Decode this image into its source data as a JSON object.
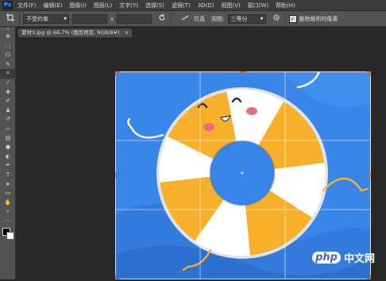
{
  "app": {
    "logo": "Ps"
  },
  "menu": [
    "文件(F)",
    "编辑(E)",
    "图像(I)",
    "图层(L)",
    "文字(Y)",
    "选择(S)",
    "滤镜(T)",
    "3D(D)",
    "视图(V)",
    "窗口(W)",
    "帮助(H)"
  ],
  "options": {
    "tool_icon": "crop-icon",
    "ratio_select": "不受约束",
    "x_label": "x",
    "straighten_label": "拉直",
    "view_label": "视图:",
    "view_select": "三等分",
    "delete_cropped_label": "删除裁剪的像素",
    "delete_cropped_checked": true
  },
  "document": {
    "tab_label": "素材3.jpg @ 66.7% (裁剪预览, RGB/8#)",
    "close": "×"
  },
  "tools": [
    "move-icon",
    "marquee-icon",
    "lasso-icon",
    "quick-select-icon",
    "crop-icon",
    "eyedropper-icon",
    "healing-icon",
    "brush-icon",
    "stamp-icon",
    "history-brush-icon",
    "eraser-icon",
    "gradient-icon",
    "blur-icon",
    "dodge-icon",
    "pen-icon",
    "type-icon",
    "path-select-icon",
    "shape-icon",
    "hand-icon",
    "zoom-icon"
  ],
  "watermark": {
    "logo": "php",
    "text": "中文网"
  },
  "colors": {
    "canvas_bg": "#3a86e8",
    "ring_orange": "#f7b02b",
    "ring_white": "#ffffff"
  }
}
